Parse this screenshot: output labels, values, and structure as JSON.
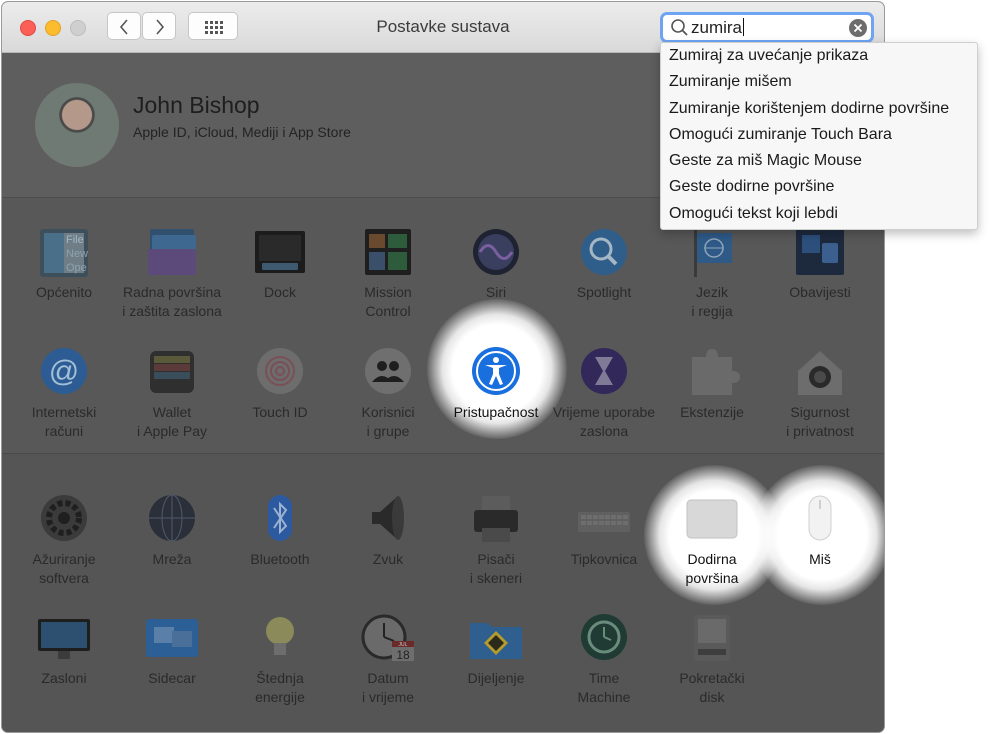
{
  "window": {
    "title": "Postavke sustava"
  },
  "search": {
    "value": "zumira"
  },
  "suggestions": [
    "Zumiraj za uvećanje prikaza",
    "Zumiranje mišem",
    "Zumiranje korištenjem dodirne površine",
    "Omogući zumiranje Touch Bara",
    "Geste za miš Magic Mouse",
    "Geste dodirne površine",
    "Omogući tekst koji lebdi"
  ],
  "account": {
    "name": "John Bishop",
    "subtitle": "Apple ID, iCloud, Mediji i App Store"
  },
  "panes": {
    "general": [
      "Općenito"
    ],
    "desktop": [
      "Radna površina",
      "i zaštita zaslona"
    ],
    "dock": [
      "Dock"
    ],
    "mission": [
      "Mission",
      "Control"
    ],
    "siri": [
      "Siri"
    ],
    "spotlight": [
      "Spotlight"
    ],
    "language": [
      "Jezik",
      "i regija"
    ],
    "notifications": [
      "Obavijesti"
    ],
    "internet": [
      "Internetski",
      "računi"
    ],
    "wallet": [
      "Wallet",
      "i Apple Pay"
    ],
    "touchid": [
      "Touch ID"
    ],
    "users": [
      "Korisnici",
      "i grupe"
    ],
    "accessibility": [
      "Pristupačnost"
    ],
    "screentime": [
      "Vrijeme uporabe",
      "zaslona"
    ],
    "extensions": [
      "Ekstenzije"
    ],
    "security": [
      "Sigurnost",
      "i privatnost"
    ],
    "update": [
      "Ažuriranje",
      "softvera"
    ],
    "network": [
      "Mreža"
    ],
    "bluetooth": [
      "Bluetooth"
    ],
    "sound": [
      "Zvuk"
    ],
    "printers": [
      "Pisači",
      "i skeneri"
    ],
    "keyboard": [
      "Tipkovnica"
    ],
    "trackpad": [
      "Dodirna",
      "površina"
    ],
    "mouse": [
      "Miš"
    ],
    "displays": [
      "Zasloni"
    ],
    "sidecar": [
      "Sidecar"
    ],
    "energy": [
      "Štednja",
      "energije"
    ],
    "datetime": [
      "Datum",
      "i vrijeme"
    ],
    "sharing": [
      "Dijeljenje"
    ],
    "timemachine": [
      "Time",
      "Machine"
    ],
    "startup": [
      "Pokretački",
      "disk"
    ]
  },
  "icon_text": {
    "calendar_month": "JUL",
    "calendar_day": "18",
    "file_lines": [
      "File",
      "New",
      "Ope"
    ]
  },
  "colors": {
    "search_focus": "#6ea4f2",
    "highlight": "#ffffff",
    "dim_overlay": "#585858"
  }
}
